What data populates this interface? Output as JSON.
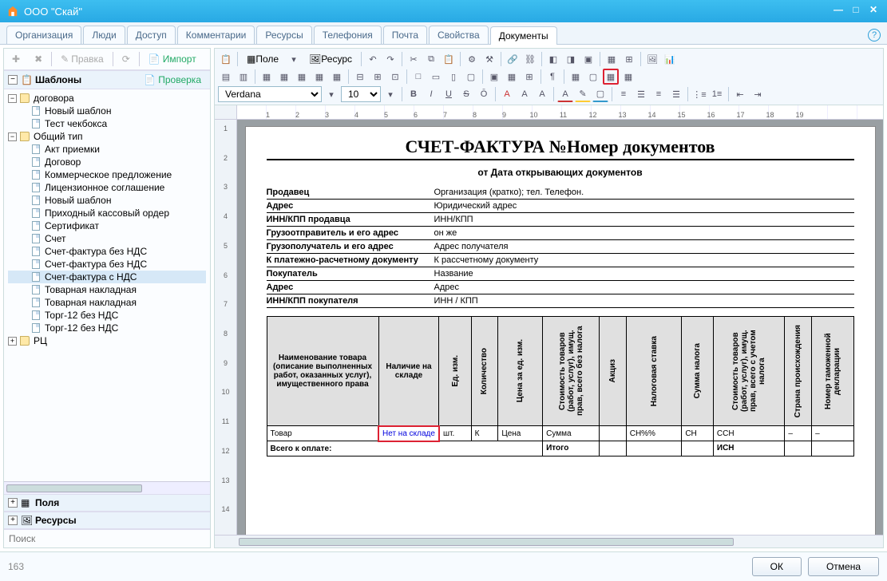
{
  "window": {
    "title": "ООО \"Скай\""
  },
  "tabs": [
    "Организация",
    "Люди",
    "Доступ",
    "Комментарии",
    "Ресурсы",
    "Телефония",
    "Почта",
    "Свойства",
    "Документы"
  ],
  "activeTab": "Документы",
  "leftToolbar": {
    "edit": "Правка",
    "import": "Импорт"
  },
  "sections": {
    "templates": "Шаблоны",
    "check": "Проверка",
    "fields": "Поля",
    "resources": "Ресурсы"
  },
  "tree": {
    "root1": {
      "label": "договора",
      "children": [
        "Новый шаблон",
        "Тест чекбокса"
      ]
    },
    "root2": {
      "label": "Общий тип",
      "children": [
        "Акт приемки",
        "Договор",
        "Коммерческое предложение",
        "Лицензионное соглашение",
        "Новый шаблон",
        "Приходный кассовый ордер",
        "Сертификат",
        "Счет",
        "Счет-фактура без НДС",
        "Счет-фактура без НДС",
        "Счет-фактура с НДС",
        "Товарная накладная",
        "Товарная накладная",
        "Торг-12 без НДС",
        "Торг-12 без НДС"
      ]
    },
    "root3": {
      "label": "РЦ"
    },
    "selected": "Счет-фактура с НДС"
  },
  "search": {
    "placeholder": "Поиск"
  },
  "editor": {
    "font": "Verdana",
    "size": "10",
    "field_btn": "Поле",
    "resource_btn": "Ресурс"
  },
  "ruler": [
    "1",
    "2",
    "3",
    "4",
    "5",
    "6",
    "7",
    "8",
    "9",
    "10",
    "11",
    "12",
    "13",
    "14",
    "15",
    "16",
    "17",
    "18",
    "19"
  ],
  "vruler": [
    "1",
    "2",
    "3",
    "4",
    "5",
    "6",
    "7",
    "8",
    "9",
    "10",
    "11",
    "12",
    "13",
    "14"
  ],
  "doc": {
    "title": "СЧЕТ-ФАКТУРА №Номер документов",
    "subtitle": "от Дата открывающих документов",
    "rows": [
      {
        "label": "Продавец",
        "value": "Организация (кратко); тел. Телефон."
      },
      {
        "label": "Адрес",
        "value": "Юридический адрес"
      },
      {
        "label": "ИНН/КПП продавца",
        "value": "ИНН/КПП"
      },
      {
        "label": "Грузоотправитель и его адрес",
        "value": "он же"
      },
      {
        "label": "Грузополучатель и его адрес",
        "value": "Адрес получателя"
      },
      {
        "label": "К платежно-расчетному документу",
        "value": "К рассчетному документу"
      },
      {
        "label": "Покупатель",
        "value": "Название"
      },
      {
        "label": "Адрес",
        "value": "Адрес"
      },
      {
        "label": "ИНН/КПП покупателя",
        "value": "ИНН / КПП"
      }
    ],
    "table": {
      "headers": [
        "Наименование товара (описание выполненных работ, оказанных услуг), имущественного права",
        "Наличие на складе",
        "Ед. изм.",
        "Количество",
        "Цена за ед. изм.",
        "Стоимость товаров (работ, услуг), имущ. прав, всего без налога",
        "Акциз",
        "Налоговая ставка",
        "Сумма налога",
        "Стоимость товаров (работ, услуг), имущ. прав, всего с учетом налога",
        "Страна происхождения",
        "Номер таможенной декларации"
      ],
      "row1": [
        "Товар",
        "Нет на складе",
        "шт.",
        "К",
        "Цена",
        "Сумма",
        "",
        "СН%%",
        "СН",
        "ССН",
        "–",
        "–"
      ],
      "footer": {
        "label": "Всего к оплате:",
        "itogo": "Итого",
        "isn": "ИСН"
      }
    }
  },
  "status": "163",
  "buttons": {
    "ok": "ОК",
    "cancel": "Отмена"
  }
}
